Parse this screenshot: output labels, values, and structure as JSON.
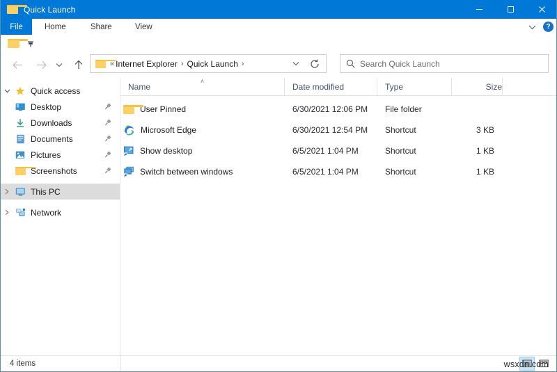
{
  "window": {
    "title": "Quick Launch",
    "title_icon": "folder-icon",
    "caption": {
      "minimize": "─",
      "maximize": "□",
      "close": "✕"
    }
  },
  "ribbon": {
    "file_tab": "File",
    "tabs": [
      {
        "label": "Home"
      },
      {
        "label": "Share"
      },
      {
        "label": "View"
      }
    ],
    "expand_icon": "chevron-down-icon",
    "help_label": "?"
  },
  "quick_access_toolbar": {
    "folder_icon": "folder-icon",
    "customize_icon": "customize-toolbar-icon"
  },
  "navigation": {
    "back_icon": "arrow-left-icon",
    "forward_icon": "arrow-right-icon",
    "recent_icon": "chevron-down-icon",
    "up_icon": "arrow-up-icon",
    "address": {
      "folder_icon": "folder-icon",
      "overflow": "«",
      "crumbs": [
        {
          "label": "Internet Explorer"
        },
        {
          "label": "Quick Launch"
        }
      ],
      "separator": "›",
      "dropdown_icon": "chevron-down-icon",
      "refresh_icon": "refresh-icon"
    },
    "search": {
      "icon": "search-icon",
      "placeholder": "Search Quick Launch",
      "value": ""
    }
  },
  "sidebar": {
    "items": [
      {
        "label": "Quick access",
        "icon": "star-icon",
        "expander": "⌄",
        "expanded": true,
        "pinned": false,
        "indent": false,
        "selected": false
      },
      {
        "label": "Desktop",
        "icon": "desktop-icon",
        "expander": "",
        "pinned": true,
        "indent": true,
        "selected": false
      },
      {
        "label": "Downloads",
        "icon": "download-icon",
        "expander": "",
        "pinned": true,
        "indent": true,
        "selected": false
      },
      {
        "label": "Documents",
        "icon": "documents-icon",
        "expander": "",
        "pinned": true,
        "indent": true,
        "selected": false
      },
      {
        "label": "Pictures",
        "icon": "pictures-icon",
        "expander": "",
        "pinned": true,
        "indent": true,
        "selected": false
      },
      {
        "label": "Screenshots",
        "icon": "folder-icon",
        "expander": "",
        "pinned": true,
        "indent": true,
        "selected": false
      },
      {
        "label": "This PC",
        "icon": "this-pc-icon",
        "expander": "›",
        "pinned": false,
        "indent": false,
        "selected": true
      },
      {
        "label": "Network",
        "icon": "network-icon",
        "expander": "›",
        "pinned": false,
        "indent": false,
        "selected": false
      }
    ]
  },
  "filelist": {
    "columns": [
      {
        "key": "name",
        "label": "Name",
        "sorted": "asc",
        "sort_caret": "˄"
      },
      {
        "key": "date",
        "label": "Date modified",
        "sorted": "",
        "sort_caret": ""
      },
      {
        "key": "type",
        "label": "Type",
        "sorted": "",
        "sort_caret": ""
      },
      {
        "key": "size",
        "label": "Size",
        "sorted": "",
        "sort_caret": ""
      }
    ],
    "rows": [
      {
        "name": "User Pinned",
        "date": "6/30/2021 12:06 PM",
        "type": "File folder",
        "size": "",
        "icon": "folder-icon"
      },
      {
        "name": "Microsoft Edge",
        "date": "6/30/2021 12:54 PM",
        "type": "Shortcut",
        "size": "3 KB",
        "icon": "edge-icon"
      },
      {
        "name": "Show desktop",
        "date": "6/5/2021 1:04 PM",
        "type": "Shortcut",
        "size": "1 KB",
        "icon": "show-desktop-icon"
      },
      {
        "name": "Switch between windows",
        "date": "6/5/2021 1:04 PM",
        "type": "Shortcut",
        "size": "1 KB",
        "icon": "switch-windows-icon"
      }
    ]
  },
  "statusbar": {
    "item_count": "4 items",
    "view_details_icon": "details-view-icon",
    "view_icons_icon": "large-icons-view-icon"
  },
  "watermark": {
    "text": "wsxdn.com"
  },
  "colors": {
    "accent": "#0078d7",
    "title_text": "#ffffff",
    "selection": "#dcdcdc",
    "hover": "#e5f1fb",
    "folder_yellow": "#fbd065",
    "header_text": "#42526c"
  }
}
